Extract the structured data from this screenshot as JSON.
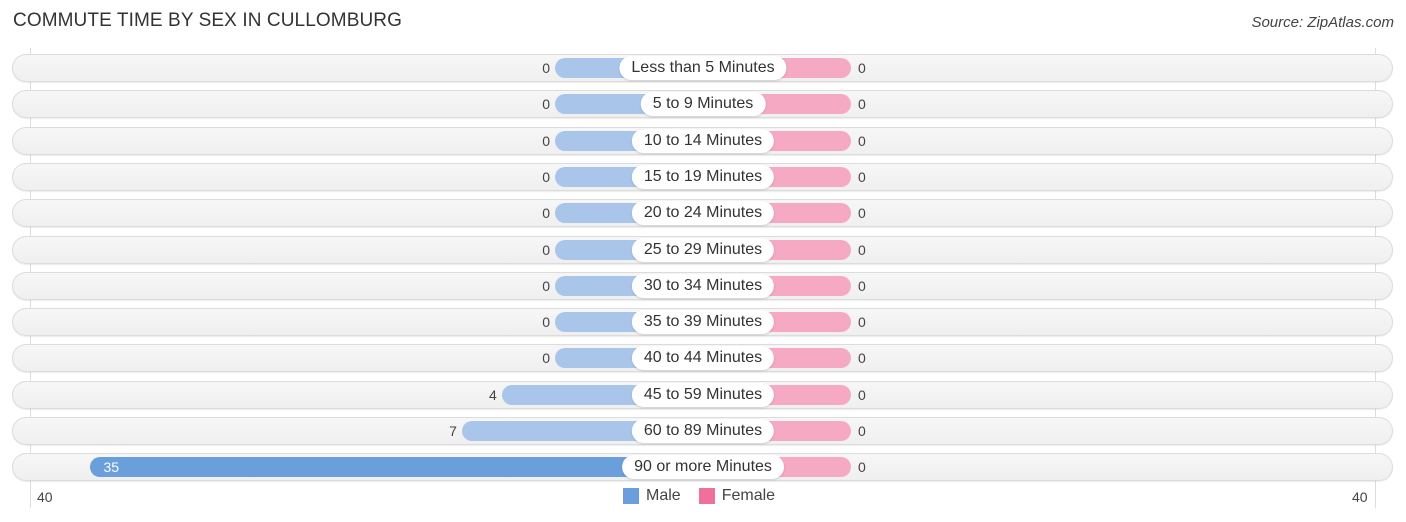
{
  "title": "COMMUTE TIME BY SEX IN CULLOMBURG",
  "source": "Source: ZipAtlas.com",
  "colors": {
    "male": "#a9c6ea",
    "male_strong": "#6a9fdc",
    "female": "#f5a9c2",
    "legend_female": "#f07099",
    "legend_male": "#6a9fdc"
  },
  "chart_data": {
    "type": "bar",
    "orientation": "horizontal-diverging",
    "title": "COMMUTE TIME BY SEX IN CULLOMBURG",
    "categories": [
      "Less than 5 Minutes",
      "5 to 9 Minutes",
      "10 to 14 Minutes",
      "15 to 19 Minutes",
      "20 to 24 Minutes",
      "25 to 29 Minutes",
      "30 to 34 Minutes",
      "35 to 39 Minutes",
      "40 to 44 Minutes",
      "45 to 59 Minutes",
      "60 to 89 Minutes",
      "90 or more Minutes"
    ],
    "series": [
      {
        "name": "Male",
        "values": [
          0,
          0,
          0,
          0,
          0,
          0,
          0,
          0,
          0,
          4,
          7,
          35
        ]
      },
      {
        "name": "Female",
        "values": [
          0,
          0,
          0,
          0,
          0,
          0,
          0,
          0,
          0,
          0,
          0,
          0
        ]
      }
    ],
    "axis": {
      "left_max_label": "40",
      "right_max_label": "40",
      "xlim": [
        -40,
        40
      ]
    },
    "legend": {
      "position": "bottom-center",
      "entries": [
        "Male",
        "Female"
      ]
    },
    "grid": false
  }
}
